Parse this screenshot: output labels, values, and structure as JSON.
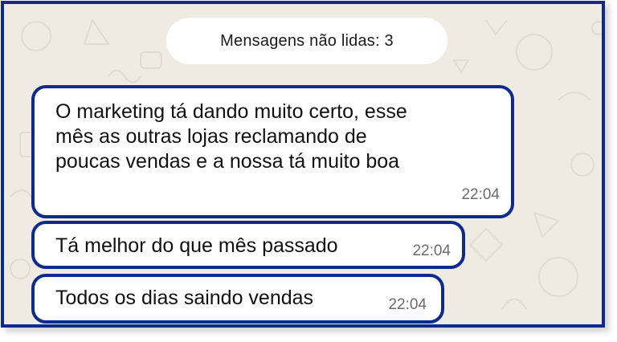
{
  "chat": {
    "unread_banner": "Mensagens não lidas: 3",
    "messages": [
      {
        "text": "O marketing tá dando muito certo, esse\nmês as outras lojas reclamando de\npoucas vendas e a nossa tá muito boa",
        "time": "22:04"
      },
      {
        "text": "Tá melhor do que mês passado",
        "time": "22:04"
      },
      {
        "text": "Todos os dias saindo vendas",
        "time": "22:04"
      }
    ]
  },
  "colors": {
    "border_accent": "#0d2a8c",
    "wallpaper": "#efeae2",
    "bubble": "#ffffff",
    "timestamp": "#6b6b6b"
  }
}
